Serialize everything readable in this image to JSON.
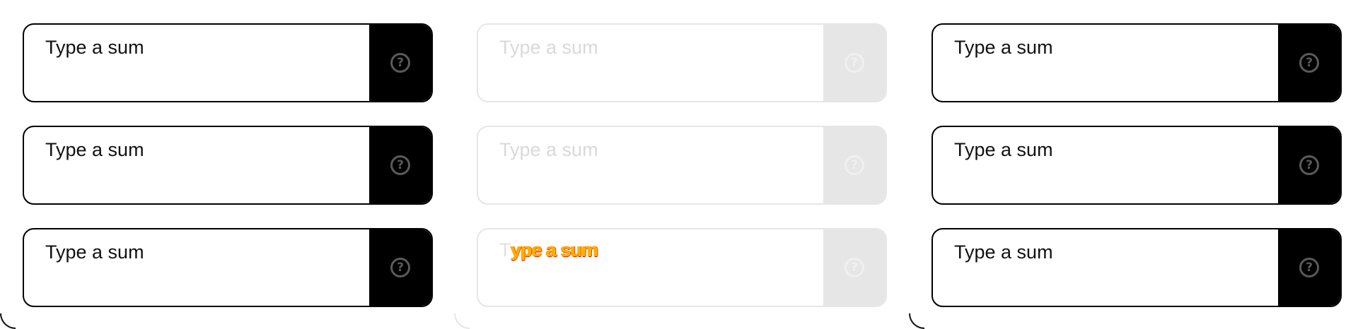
{
  "columns": [
    {
      "state": "enabled",
      "fields": [
        {
          "placeholder": "Type a sum",
          "help_icon": "question-circle-icon"
        },
        {
          "placeholder": "Type a sum",
          "help_icon": "question-circle-icon"
        },
        {
          "placeholder": "Type a sum",
          "help_icon": "question-circle-icon"
        }
      ]
    },
    {
      "state": "disabled",
      "fields": [
        {
          "placeholder": "Type a sum",
          "help_icon": "question-circle-icon"
        },
        {
          "placeholder": "Type a sum",
          "help_icon": "question-circle-icon"
        },
        {
          "placeholder": "",
          "overlay_first_char": "T",
          "overlay_text": "ype a sum",
          "help_icon": "question-circle-icon"
        }
      ]
    },
    {
      "state": "enabled",
      "fields": [
        {
          "placeholder": "Type a sum",
          "help_icon": "question-circle-icon"
        },
        {
          "placeholder": "Type a sum",
          "help_icon": "question-circle-icon"
        },
        {
          "placeholder": "Type a sum",
          "help_icon": "question-circle-icon"
        }
      ]
    }
  ],
  "help_glyph": "?",
  "colors": {
    "border": "#000000",
    "help_bg": "#000000",
    "icon": "#5a5a5a",
    "disabled_border": "#e6e6e6",
    "disabled_text": "#d9d9d9",
    "glitch_text": "#ffb000"
  }
}
